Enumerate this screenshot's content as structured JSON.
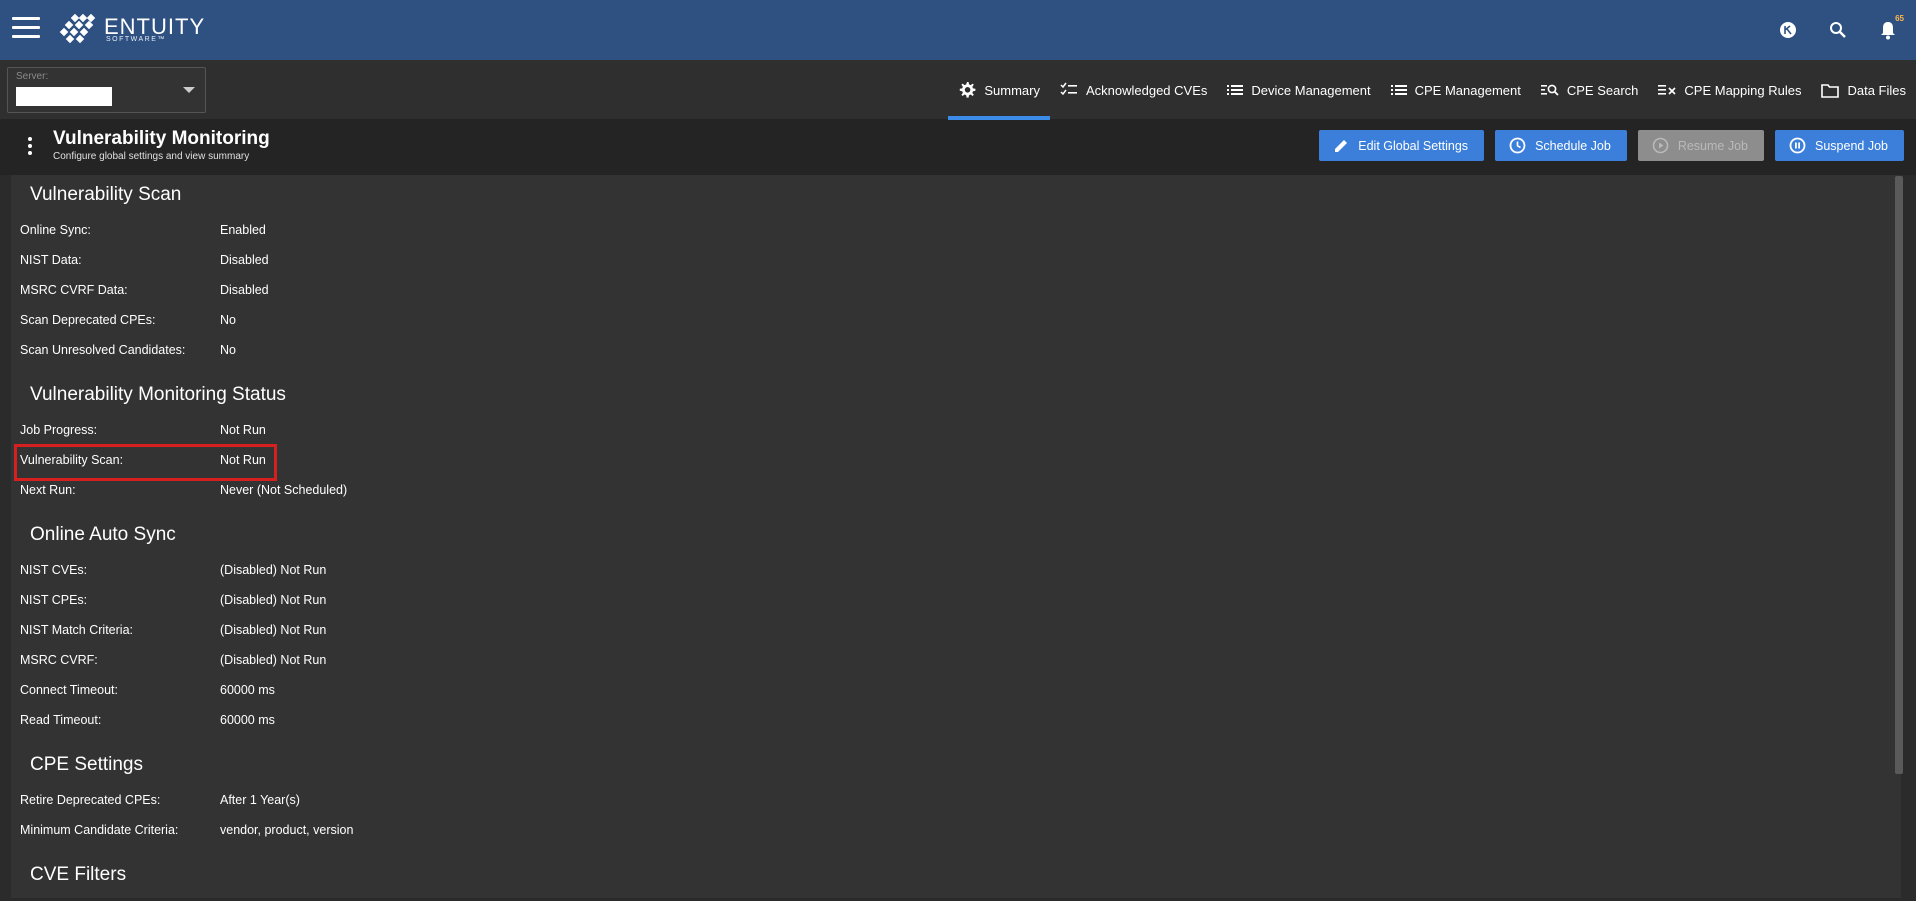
{
  "brand": {
    "name": "ENTUITY",
    "sub": "SOFTWARE™"
  },
  "notifications": {
    "count": "65"
  },
  "server": {
    "label": "Server:"
  },
  "tabs": [
    {
      "label": "Summary",
      "icon": "gear-icon",
      "active": true
    },
    {
      "label": "Acknowledged CVEs",
      "icon": "checklist-icon",
      "active": false
    },
    {
      "label": "Device Management",
      "icon": "list-icon",
      "active": false
    },
    {
      "label": "CPE Management",
      "icon": "list-icon",
      "active": false
    },
    {
      "label": "CPE Search",
      "icon": "list-search-icon",
      "active": false
    },
    {
      "label": "CPE Mapping Rules",
      "icon": "list-remove-icon",
      "active": false
    },
    {
      "label": "Data Files",
      "icon": "folder-icon",
      "active": false
    }
  ],
  "header": {
    "title": "Vulnerability Monitoring",
    "subtitle": "Configure global settings and view summary"
  },
  "actions": {
    "edit_global_settings": "Edit Global Settings",
    "schedule_job": "Schedule Job",
    "resume_job": "Resume Job",
    "suspend_job": "Suspend Job"
  },
  "sections": {
    "vulnerability_scan": {
      "title": "Vulnerability Scan",
      "rows": [
        {
          "label": "Online Sync:",
          "value": "Enabled"
        },
        {
          "label": "NIST Data:",
          "value": "Disabled"
        },
        {
          "label": "MSRC CVRF Data:",
          "value": "Disabled"
        },
        {
          "label": "Scan Deprecated CPEs:",
          "value": "No"
        },
        {
          "label": "Scan Unresolved Candidates:",
          "value": "No"
        }
      ]
    },
    "monitoring_status": {
      "title": "Vulnerability Monitoring Status",
      "rows": [
        {
          "label": "Job Progress:",
          "value": "Not Run"
        },
        {
          "label": "Vulnerability Scan:",
          "value": "Not Run"
        },
        {
          "label": "Next Run:",
          "value": "Never (Not Scheduled)"
        }
      ]
    },
    "online_auto_sync": {
      "title": "Online Auto Sync",
      "rows": [
        {
          "label": "NIST CVEs:",
          "value": "(Disabled) Not Run"
        },
        {
          "label": "NIST CPEs:",
          "value": "(Disabled) Not Run"
        },
        {
          "label": "NIST Match Criteria:",
          "value": "(Disabled) Not Run"
        },
        {
          "label": "MSRC CVRF:",
          "value": "(Disabled) Not Run"
        },
        {
          "label": "Connect Timeout:",
          "value": "60000 ms"
        },
        {
          "label": "Read Timeout:",
          "value": "60000 ms"
        }
      ]
    },
    "cpe_settings": {
      "title": "CPE Settings",
      "rows": [
        {
          "label": "Retire Deprecated CPEs:",
          "value": "After 1 Year(s)"
        },
        {
          "label": "Minimum Candidate Criteria:",
          "value": "vendor, product, version"
        }
      ]
    },
    "cve_filters": {
      "title": "CVE Filters"
    }
  },
  "colors": {
    "topbar": "#2e5182",
    "accent": "#3b7fdb",
    "highlight": "#d62020"
  }
}
